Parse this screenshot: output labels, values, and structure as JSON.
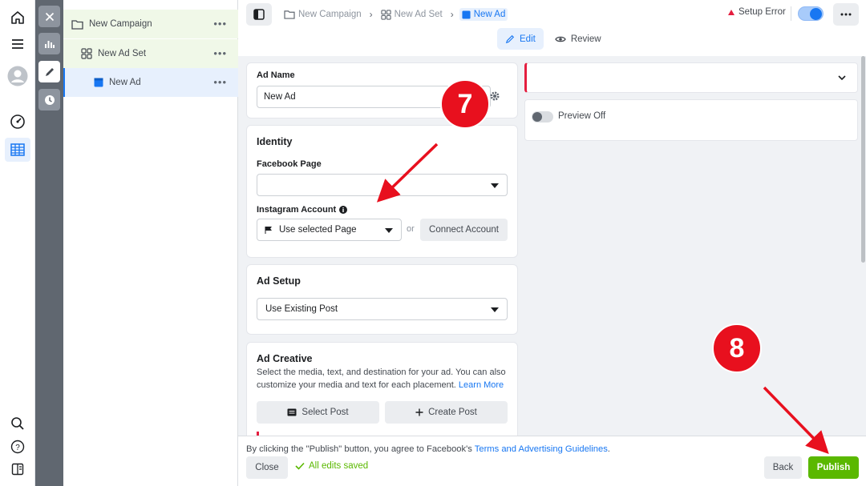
{
  "tree": {
    "campaign_label": "New Campaign",
    "adset_label": "New Ad Set",
    "ad_label": "New Ad",
    "more": "•••"
  },
  "breadcrumb": {
    "campaign": "New Campaign",
    "adset": "New Ad Set",
    "ad": "New Ad"
  },
  "status": {
    "setup_error": "Setup Error"
  },
  "tabs": {
    "edit": "Edit",
    "review": "Review"
  },
  "ad_name": {
    "label": "Ad Name",
    "value": "New Ad"
  },
  "identity": {
    "heading": "Identity",
    "facebook_page_label": "Facebook Page",
    "facebook_page_value": "",
    "instagram_label": "Instagram Account",
    "instagram_value": "Use selected Page",
    "or": "or",
    "connect_label": "Connect Account"
  },
  "ad_setup": {
    "heading": "Ad Setup",
    "value": "Use Existing Post"
  },
  "ad_creative": {
    "heading": "Ad Creative",
    "desc": "Select the media, text, and destination for your ad. You can also customize your media and text for each placement.",
    "learn_more": "Learn More",
    "select_post": "Select Post",
    "create_post": "Create Post"
  },
  "preview": {
    "toggle_label": "Preview Off",
    "toggle_on": false
  },
  "footer": {
    "terms_prefix": "By clicking the \"Publish\" button, you agree to Facebook's ",
    "terms_link": "Terms and Advertising Guidelines",
    "terms_suffix": ".",
    "close": "Close",
    "saved": "All edits saved",
    "back": "Back",
    "publish": "Publish"
  },
  "annotations": {
    "step7": "7",
    "step8": "8"
  },
  "colors": {
    "accent": "#1877f2",
    "publish": "#5ab800",
    "error": "#e41e3f",
    "annotation": "#e8101e"
  }
}
